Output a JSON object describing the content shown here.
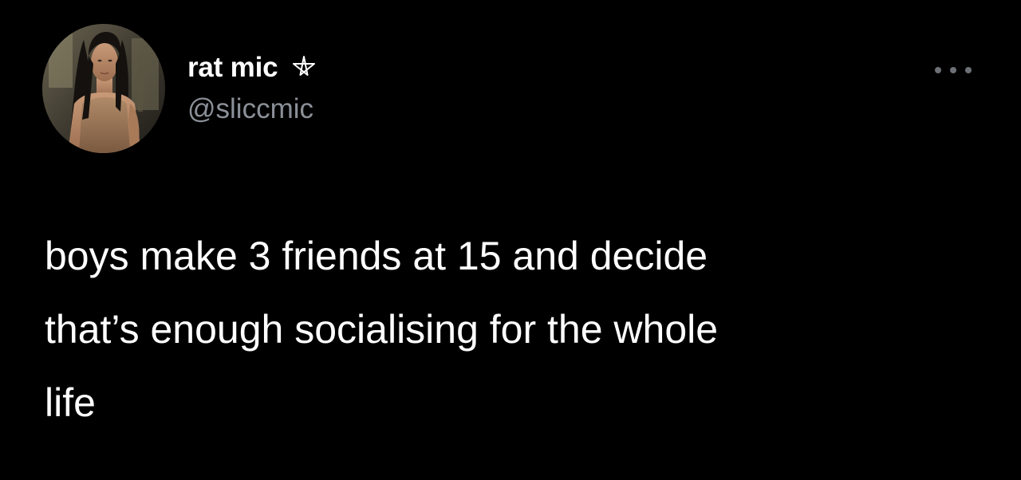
{
  "tweet": {
    "author": {
      "display_name": "rat mic",
      "badge_icon": "pentagram-icon",
      "handle": "@sliccmic"
    },
    "more_icon": "more-dots-icon",
    "text": "boys make 3 friends at 15 and decide\nthat’s enough socialising for the whole\nlife"
  },
  "colors": {
    "background": "#000000",
    "primary_text": "#ffffff",
    "secondary_text": "#8b9098",
    "more_dots": "#6d7177"
  }
}
